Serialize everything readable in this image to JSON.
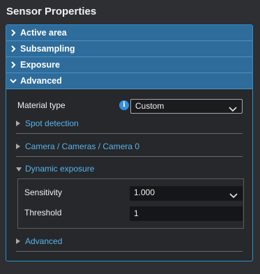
{
  "title": "Sensor Properties",
  "sections": [
    {
      "label": "Active area"
    },
    {
      "label": "Subsampling"
    },
    {
      "label": "Exposure"
    },
    {
      "label": "Advanced"
    }
  ],
  "material": {
    "label": "Material type",
    "value": "Custom",
    "info_icon": "info-icon"
  },
  "spot_detection": {
    "label": "Spot detection"
  },
  "camera": {
    "label": "Camera / Cameras / Camera 0"
  },
  "dynamic_exposure": {
    "label": "Dynamic exposure",
    "sensitivity": {
      "label": "Sensitivity",
      "value": "1.000"
    },
    "threshold": {
      "label": "Threshold",
      "value": "1"
    }
  },
  "advanced_sub": {
    "label": "Advanced"
  },
  "colors": {
    "accent": "#2f8fcf",
    "header_bg": "#2e6c9b",
    "link": "#58b3ee"
  }
}
